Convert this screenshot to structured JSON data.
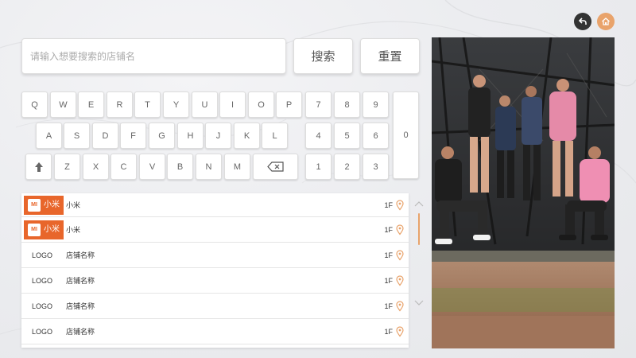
{
  "search": {
    "placeholder": "请输入想要搜索的店铺名",
    "search_label": "搜索",
    "reset_label": "重置"
  },
  "keyboard": {
    "row1": [
      "Q",
      "W",
      "E",
      "R",
      "T",
      "Y",
      "U",
      "I",
      "O",
      "P"
    ],
    "row2": [
      "A",
      "S",
      "D",
      "F",
      "G",
      "H",
      "J",
      "K",
      "L"
    ],
    "row3": [
      "Z",
      "X",
      "C",
      "V",
      "B",
      "N",
      "M"
    ],
    "num_row1": [
      "7",
      "8",
      "9"
    ],
    "num_row2": [
      "4",
      "5",
      "6"
    ],
    "num_row3": [
      "1",
      "2",
      "3"
    ],
    "zero": "0"
  },
  "stores": [
    {
      "logo": "小米",
      "name": "小米",
      "floor": "1F"
    },
    {
      "logo": "小米",
      "name": "小米",
      "floor": "1F"
    },
    {
      "logo": "LOGO",
      "name": "店铺名称",
      "floor": "1F"
    },
    {
      "logo": "LOGO",
      "name": "店铺名称",
      "floor": "1F"
    },
    {
      "logo": "LOGO",
      "name": "店铺名称",
      "floor": "1F"
    },
    {
      "logo": "LOGO",
      "name": "店铺名称",
      "floor": "1F"
    }
  ],
  "brand_logo_mark": "MI",
  "colors": {
    "accent": "#e9a36b",
    "brand_orange": "#e8662b",
    "dark_button": "#333333"
  },
  "icons": {
    "back": "back-arrow-icon",
    "home": "home-icon",
    "shift": "shift-up-icon",
    "delete": "backspace-icon",
    "location": "location-pin-icon",
    "scroll_up": "chevron-up-icon",
    "scroll_down": "chevron-down-icon"
  }
}
